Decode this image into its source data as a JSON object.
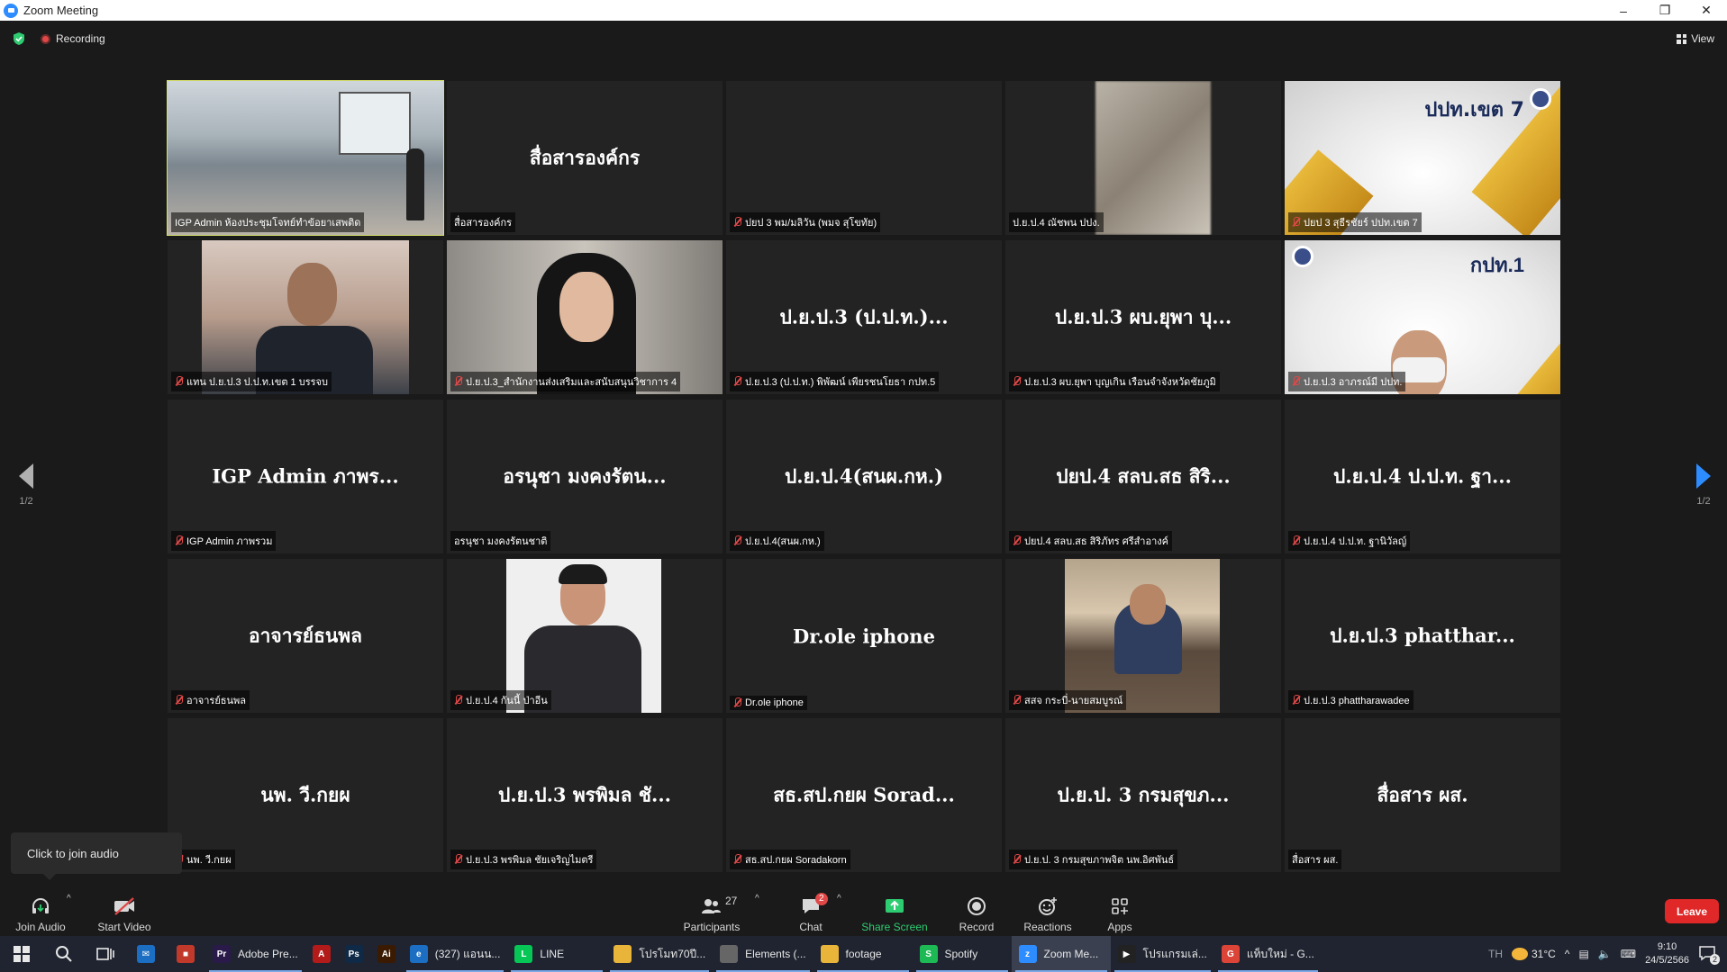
{
  "window": {
    "title": "Zoom Meeting"
  },
  "topbar": {
    "recording_label": "Recording",
    "view_label": "View"
  },
  "colors": {
    "accent": "#2d8cff",
    "active_speaker": "#d4e06a",
    "muted_mic": "#e04848",
    "leave": "#e02828",
    "share_green": "#2ecc71"
  },
  "gallery": {
    "page_indicator_left": "1/2",
    "page_indicator_right": "1/2",
    "tiles": [
      {
        "name": "IGP Admin ห้องประชุมโจทย์ทำข้อยาเสพติด",
        "big": "",
        "muted": false,
        "video": "room",
        "active": true
      },
      {
        "name": "สื่อสารองค์กร",
        "big": "สื่อสารองค์กร",
        "muted": false,
        "video": ""
      },
      {
        "name": "ปยป 3 พม/มลิวัน (พมจ สุโขทัย)",
        "big": "",
        "muted": true,
        "video": ""
      },
      {
        "name": "ป.ย.ป.4 ณัชพน ปปง.",
        "big": "",
        "muted": false,
        "video": "blur"
      },
      {
        "name": "ปยป 3 สุธีรชัยร์ ปปท.เขต 7",
        "big": "",
        "muted": true,
        "video": "banner7"
      },
      {
        "name": "แทน ป.ย.ป.3 ป.ป.ท.เขต 1 บรรจบ",
        "big": "",
        "muted": true,
        "video": "man"
      },
      {
        "name": "ป.ย.ป.3_สำนักงานส่งเสริมและสนับสนุนวิชาการ 4",
        "big": "",
        "muted": true,
        "video": "woman"
      },
      {
        "name": "ป.ย.ป.3 (ป.ป.ท.) พิพัฒน์ เพียรชนโยธา กปท.5",
        "big": "ป.ย.ป.3 (ป.ป.ท.)...",
        "muted": true,
        "video": ""
      },
      {
        "name": "ป.ย.ป.3 ผบ.ยุพา บุญเกิน เรือนจำจังหวัดชัยภูมิ",
        "big": "ป.ย.ป.3 ผบ.ยุพา บุ...",
        "muted": true,
        "video": ""
      },
      {
        "name": "ป.ย.ป.3 อาภรณ์มี ปปท.",
        "big": "",
        "muted": true,
        "video": "mask"
      },
      {
        "name": "IGP Admin ภาพรวม",
        "big": "IGP Admin ภาพร...",
        "muted": true,
        "video": ""
      },
      {
        "name": "อรนุชา มงคงรัตนชาติ",
        "big": "อรนุชา มงคงรัตน...",
        "muted": false,
        "video": ""
      },
      {
        "name": "ป.ย.ป.4(สนผ.กห.)",
        "big": "ป.ย.ป.4(สนผ.กห.)",
        "muted": true,
        "video": ""
      },
      {
        "name": "ปยป.4 สลบ.สธ สิริภัทร ศรีสำอางค์",
        "big": "ปยป.4 สลบ.สธ สิริ...",
        "muted": true,
        "video": ""
      },
      {
        "name": "ป.ย.ป.4 ป.ป.ท. ฐานิวัลญ์",
        "big": "ป.ย.ป.4 ป.ป.ท. ฐา...",
        "muted": true,
        "video": ""
      },
      {
        "name": "อาจารย์ธนพล",
        "big": "อาจารย์ธนพล",
        "muted": true,
        "video": ""
      },
      {
        "name": "ป.ย.ป.4 กันนี้ ป่าอีน",
        "big": "",
        "muted": true,
        "video": "suit"
      },
      {
        "name": "Dr.ole iphone",
        "big": "Dr.ole iphone",
        "muted": true,
        "video": ""
      },
      {
        "name": "สสจ กระบี่-นายสมบูรณ์",
        "big": "",
        "muted": true,
        "video": "desk"
      },
      {
        "name": "ป.ย.ป.3 phattharawadee",
        "big": "ป.ย.ป.3 phatthar...",
        "muted": true,
        "video": ""
      },
      {
        "name": "นพ. วี.กยผ",
        "big": "นพ. วี.กยผ",
        "muted": true,
        "video": ""
      },
      {
        "name": "ป.ย.ป.3 พรพิมล ชัยเจริญไมตรี",
        "big": "ป.ย.ป.3 พรพิมล ชั...",
        "muted": true,
        "video": ""
      },
      {
        "name": "สธ.สป.กยผ Soradakorn",
        "big": "สธ.สป.กยผ Sorad...",
        "muted": true,
        "video": ""
      },
      {
        "name": "ป.ย.ป. 3 กรมสุขภาพจิต นพ.อิศพันธ์",
        "big": "ป.ย.ป. 3 กรมสุขภ...",
        "muted": true,
        "video": ""
      },
      {
        "name": "สื่อสาร ผส.",
        "big": "สื่อสาร ผส.",
        "muted": false,
        "video": ""
      }
    ]
  },
  "banners": {
    "tile5_logo": "ปปท.เขต 7",
    "tile10_logo": "กปท.1"
  },
  "tooltip": {
    "text": "Click to join audio"
  },
  "toolbar": {
    "join_audio": "Join Audio",
    "start_video": "Start Video",
    "participants": "Participants",
    "participants_count": "27",
    "chat": "Chat",
    "chat_badge": "2",
    "share_screen": "Share Screen",
    "record": "Record",
    "reactions": "Reactions",
    "apps": "Apps",
    "leave": "Leave"
  },
  "taskbar": {
    "apps": [
      {
        "label": "Adobe Pre...",
        "icon": "Pr",
        "color": "#2a1a4a"
      },
      {
        "label": "",
        "icon": "A",
        "color": "#b31b1b"
      },
      {
        "label": "",
        "icon": "Ps",
        "color": "#0e2a47"
      },
      {
        "label": "",
        "icon": "Ai",
        "color": "#3a1a00"
      },
      {
        "label": "(327) แอนน...",
        "icon": "e",
        "color": "#1b6ec2"
      },
      {
        "label": "LINE",
        "icon": "L",
        "color": "#06c755"
      },
      {
        "label": "โปรโมท70ปี...",
        "icon": "",
        "color": "#e8b53a"
      },
      {
        "label": "Elements (...",
        "icon": "",
        "color": "#666666"
      },
      {
        "label": "footage",
        "icon": "",
        "color": "#e8b53a"
      },
      {
        "label": "Spotify",
        "icon": "S",
        "color": "#1db954"
      },
      {
        "label": "Zoom Me...",
        "icon": "z",
        "color": "#2d8cff"
      },
      {
        "label": "โปรแกรมเล่...",
        "icon": "▶",
        "color": "#222222"
      },
      {
        "label": "แท็บใหม่ - G...",
        "icon": "G",
        "color": "#db4437"
      }
    ],
    "lang": "TH",
    "weather": "31°C",
    "time": "9:10",
    "date": "24/5/2566",
    "notification_count": "2"
  }
}
